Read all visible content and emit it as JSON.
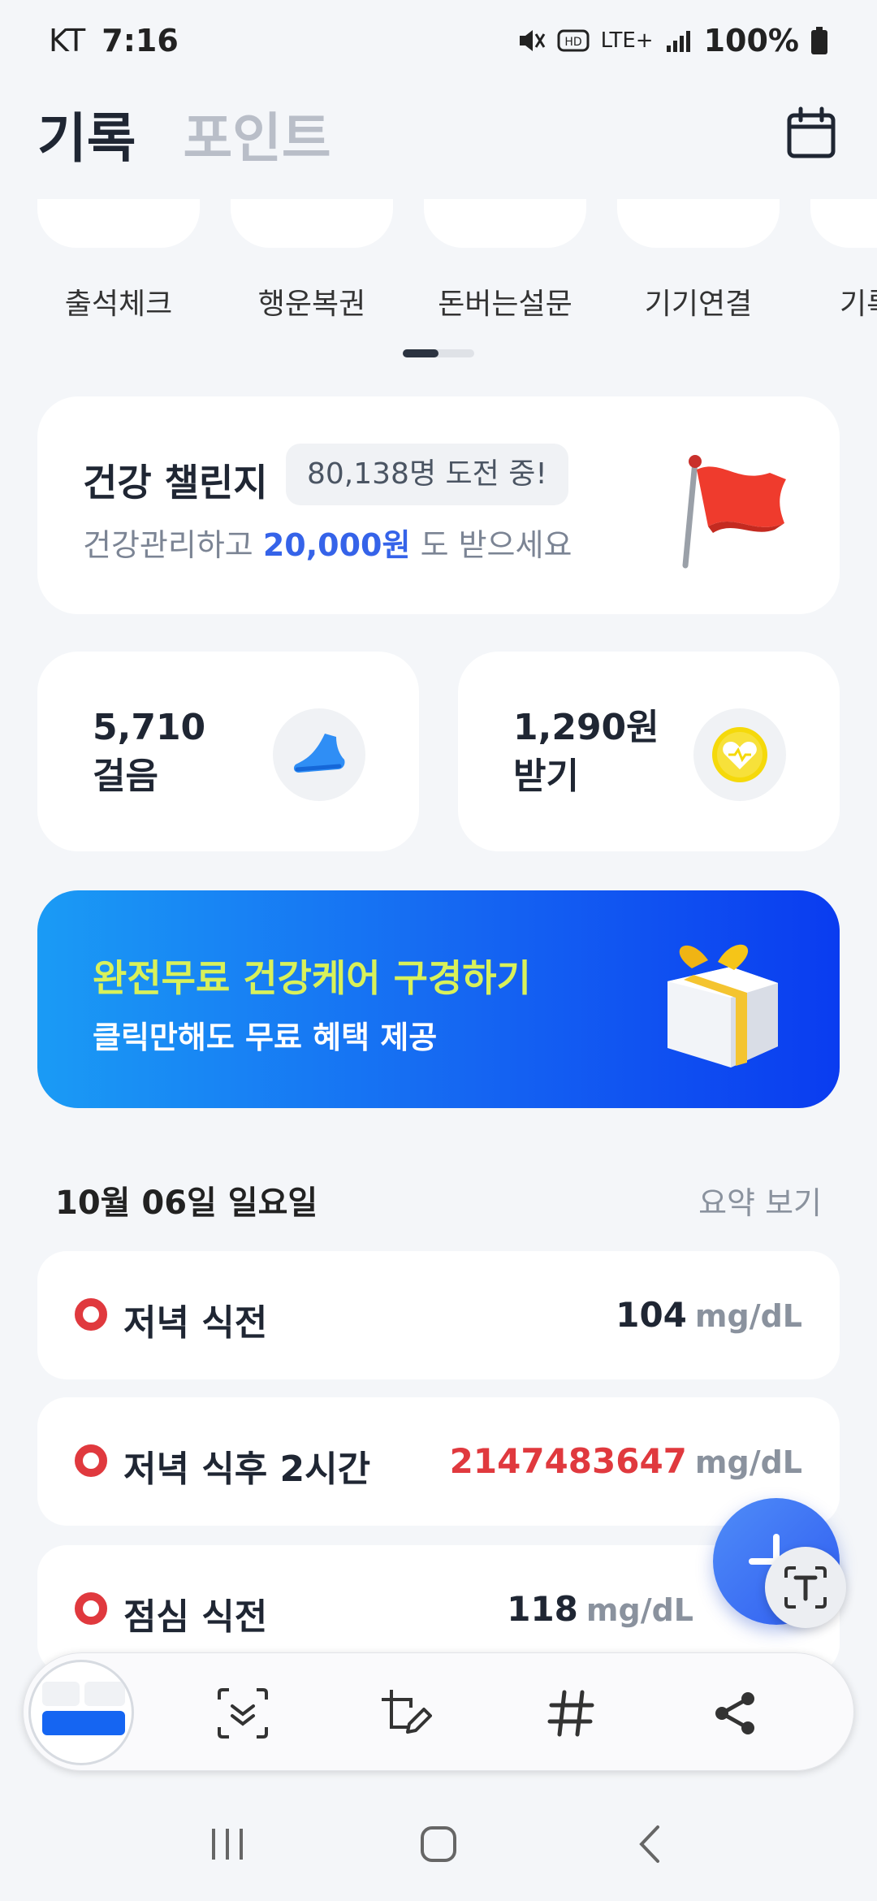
{
  "status_bar": {
    "carrier": "KT",
    "time": "7:16",
    "network": "LTE+",
    "battery": "100%"
  },
  "header": {
    "tabs": [
      "기록",
      "포인트"
    ],
    "active_tab": "기록"
  },
  "quick_menu": {
    "items": [
      "출석체크",
      "행운복권",
      "돈버는설문",
      "기기연결",
      "기록"
    ]
  },
  "challenge": {
    "title": "건강 챌린지",
    "participants": "80,138명 도전 중!",
    "subtitle_prefix": "건강관리하고",
    "amount": "20,000원",
    "subtitle_suffix": "도 받으세요"
  },
  "stats": {
    "steps_value": "5,710",
    "steps_label": "걸음",
    "points_value": "1,290원",
    "points_label": "받기"
  },
  "banner": {
    "title": "완전무료 건강케어 구경하기",
    "subtitle": "클릭만해도 무료 혜택 제공"
  },
  "records": {
    "date": "10월 06일 일요일",
    "summary_link": "요약 보기",
    "items": [
      {
        "name": "저녁 식전",
        "value": "104",
        "unit": "mg/dL"
      },
      {
        "name": "저녁 식후 2시간",
        "value": "2147483647",
        "unit": "mg/dL"
      },
      {
        "name": "점심 식전",
        "value": "118",
        "unit": "mg/dL"
      }
    ]
  },
  "colors": {
    "accent_blue": "#3563e9",
    "alert_red": "#e0393e",
    "banner_title": "#d8f15a"
  },
  "icons": {
    "header": "calendar-icon",
    "steps": "sneaker-icon",
    "points": "coin-heart-icon",
    "fab": "plus-icon",
    "text_scan": "text-scan-icon",
    "toolbar": [
      "scroll-capture-icon",
      "edit-crop-icon",
      "hashtag-icon",
      "share-icon"
    ],
    "nav": [
      "recents-icon",
      "home-icon",
      "back-icon"
    ]
  }
}
